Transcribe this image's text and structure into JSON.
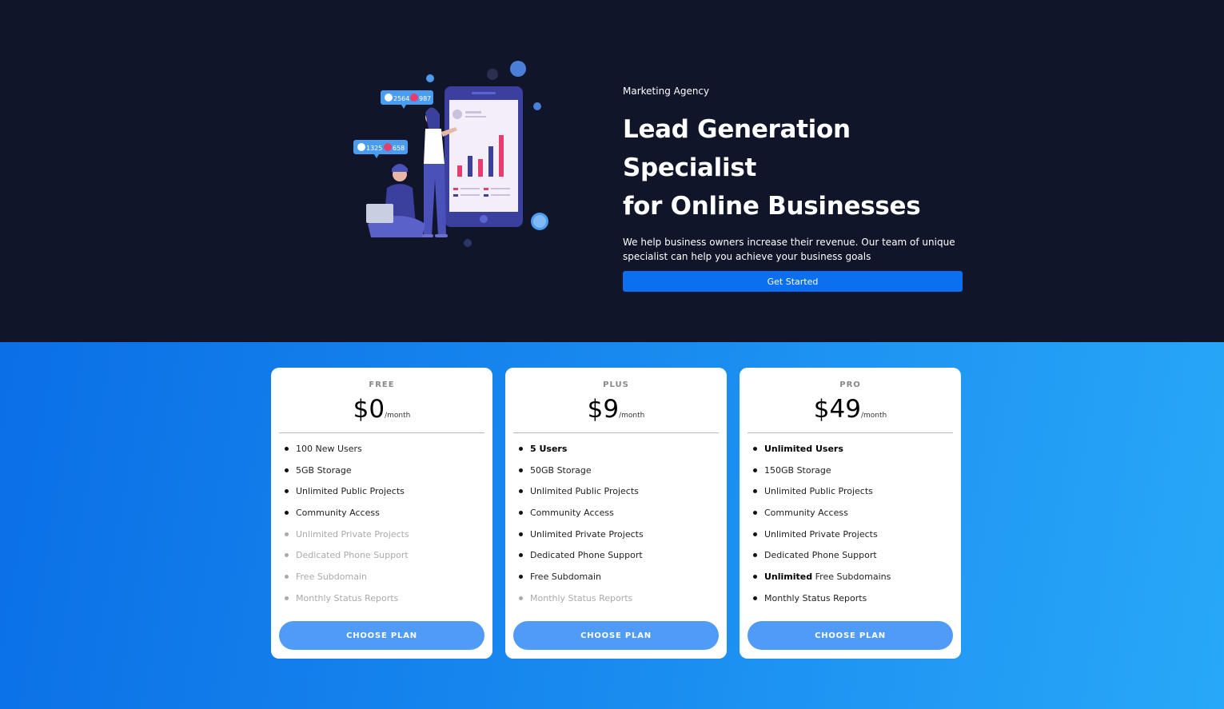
{
  "hero": {
    "eyebrow": "Marketing Agency",
    "headline_line1": "Lead Generation Specialist",
    "headline_line2": "for Online Businesses",
    "description": "We help business owners increase their revenue. Our team of unique specialist can help you achieve your business goals",
    "cta_label": "Get Started",
    "illustration": {
      "badge1_likes": "2564",
      "badge1_hearts": "987",
      "badge2_likes": "1325",
      "badge2_hearts": "658"
    }
  },
  "plans": [
    {
      "tier": "FREE",
      "price": "$0",
      "period": "/month",
      "button_label": "CHOOSE PLAN",
      "features": [
        {
          "bold": "",
          "text": "100 New Users",
          "muted": false
        },
        {
          "bold": "",
          "text": "5GB Storage",
          "muted": false
        },
        {
          "bold": "",
          "text": "Unlimited Public Projects",
          "muted": false
        },
        {
          "bold": "",
          "text": "Community Access",
          "muted": false
        },
        {
          "bold": "",
          "text": "Unlimited Private Projects",
          "muted": true
        },
        {
          "bold": "",
          "text": "Dedicated Phone Support",
          "muted": true
        },
        {
          "bold": "",
          "text": "Free Subdomain",
          "muted": true
        },
        {
          "bold": "",
          "text": "Monthly Status Reports",
          "muted": true
        }
      ]
    },
    {
      "tier": "PLUS",
      "price": "$9",
      "period": "/month",
      "button_label": "CHOOSE PLAN",
      "features": [
        {
          "bold": "5 Users",
          "text": "",
          "muted": false
        },
        {
          "bold": "",
          "text": "50GB Storage",
          "muted": false
        },
        {
          "bold": "",
          "text": "Unlimited Public Projects",
          "muted": false
        },
        {
          "bold": "",
          "text": "Community Access",
          "muted": false
        },
        {
          "bold": "",
          "text": "Unlimited Private Projects",
          "muted": false
        },
        {
          "bold": "",
          "text": "Dedicated Phone Support",
          "muted": false
        },
        {
          "bold": "",
          "text": "Free Subdomain",
          "muted": false
        },
        {
          "bold": "",
          "text": "Monthly Status Reports",
          "muted": true
        }
      ]
    },
    {
      "tier": "PRO",
      "price": "$49",
      "period": "/month",
      "button_label": "CHOOSE PLAN",
      "features": [
        {
          "bold": "Unlimited Users",
          "text": "",
          "muted": false
        },
        {
          "bold": "",
          "text": "150GB Storage",
          "muted": false
        },
        {
          "bold": "",
          "text": "Unlimited Public Projects",
          "muted": false
        },
        {
          "bold": "",
          "text": "Community Access",
          "muted": false
        },
        {
          "bold": "",
          "text": "Unlimited Private Projects",
          "muted": false
        },
        {
          "bold": "",
          "text": "Dedicated Phone Support",
          "muted": false
        },
        {
          "bold": "Unlimited",
          "text": " Free Subdomains",
          "muted": false
        },
        {
          "bold": "",
          "text": "Monthly Status Reports",
          "muted": false
        }
      ]
    }
  ],
  "colors": {
    "hero_bg": "#11152a",
    "cta": "#0b6ff0",
    "choose_button": "#4f9bf6",
    "gradient_start": "#0b6fe6",
    "gradient_end": "#28a8f8"
  }
}
